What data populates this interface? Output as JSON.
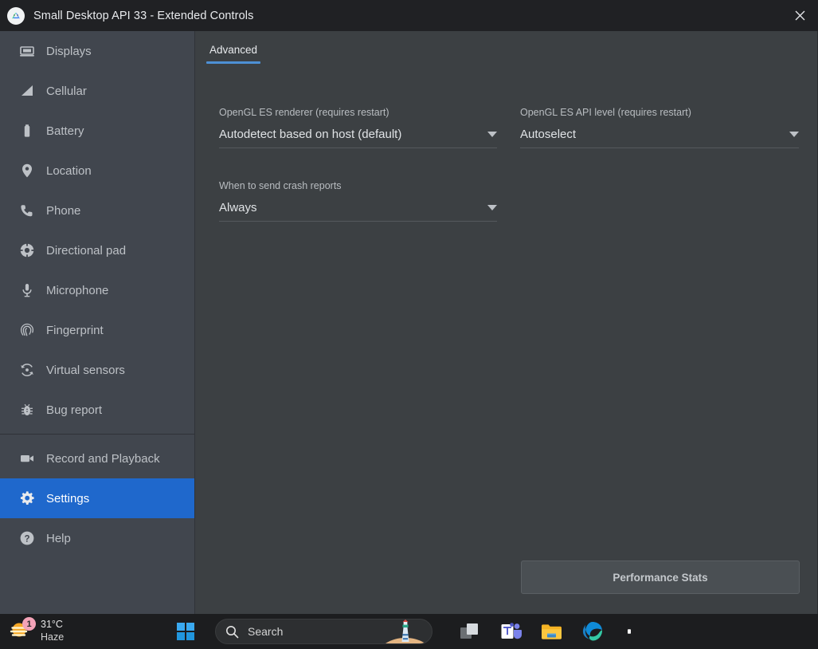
{
  "window": {
    "title": "Small Desktop API 33 - Extended Controls",
    "app_icon": "android-studio-icon",
    "close_label": "close-icon"
  },
  "theme": {
    "window_bg": "#3c4043",
    "titlebar_bg": "#202124",
    "sidebar_bg": "#41464e",
    "accent_blue": "#1f68cc",
    "tab_underline": "#4d90d5",
    "text_primary": "#e8eaed",
    "text_secondary": "#bdc1c6",
    "taskbar_bg": "#1c1d1f"
  },
  "sidebar": {
    "items": [
      {
        "label": "Displays",
        "icon": "monitor-icon",
        "selected": false
      },
      {
        "label": "Cellular",
        "icon": "signal-bars-icon",
        "selected": false
      },
      {
        "label": "Battery",
        "icon": "battery-icon",
        "selected": false
      },
      {
        "label": "Location",
        "icon": "map-pin-icon",
        "selected": false
      },
      {
        "label": "Phone",
        "icon": "phone-handset-icon",
        "selected": false
      },
      {
        "label": "Directional pad",
        "icon": "dpad-icon",
        "selected": false
      },
      {
        "label": "Microphone",
        "icon": "microphone-icon",
        "selected": false
      },
      {
        "label": "Fingerprint",
        "icon": "fingerprint-icon",
        "selected": false
      },
      {
        "label": "Virtual sensors",
        "icon": "rotate-sensor-icon",
        "selected": false
      },
      {
        "label": "Bug report",
        "icon": "bug-icon",
        "selected": false
      }
    ],
    "items_after_divider": [
      {
        "label": "Record and Playback",
        "icon": "video-camera-icon",
        "selected": false
      },
      {
        "label": "Settings",
        "icon": "gear-icon",
        "selected": true
      },
      {
        "label": "Help",
        "icon": "question-circle-icon",
        "selected": false
      }
    ]
  },
  "main": {
    "tabs": [
      {
        "label": "Advanced",
        "active": true
      }
    ],
    "fields_left": [
      {
        "label": "OpenGL ES renderer (requires restart)",
        "value": "Autodetect based on host (default)",
        "icon": "chevron-down-icon"
      },
      {
        "label": "When to send crash reports",
        "value": "Always",
        "icon": "chevron-down-icon"
      }
    ],
    "fields_right": [
      {
        "label": "OpenGL ES API level (requires restart)",
        "value": "Autoselect",
        "icon": "chevron-down-icon"
      }
    ],
    "performance_stats_label": "Performance Stats"
  },
  "taskbar": {
    "weather": {
      "temperature": "31°C",
      "condition": "Haze",
      "badge_count": "1",
      "icon": "haze-sun-icon"
    },
    "start_label": "start-icon",
    "search": {
      "placeholder": "Search",
      "icon": "search-icon",
      "thumbnail": "lighthouse-thumbnail"
    },
    "apps": [
      {
        "name": "task-view-icon",
        "label": "Task View"
      },
      {
        "name": "microsoft-teams-icon",
        "label": "Microsoft Teams"
      },
      {
        "name": "file-explorer-icon",
        "label": "File Explorer"
      },
      {
        "name": "microsoft-edge-icon",
        "label": "Microsoft Edge"
      },
      {
        "name": "white-app-icon",
        "label": ""
      }
    ]
  }
}
